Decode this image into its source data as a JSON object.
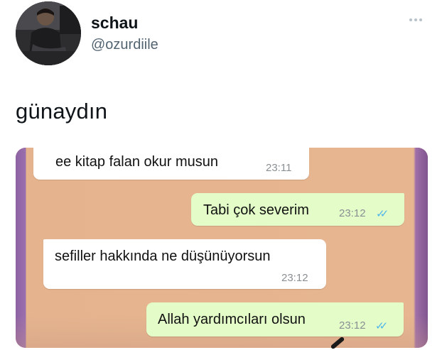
{
  "tweet": {
    "author": {
      "display_name": "schau",
      "handle": "@ozurdiile"
    },
    "text": "günaydın",
    "more_icon": "ellipsis-icon"
  },
  "chat": {
    "messages": [
      {
        "direction": "incoming",
        "text": "ee kitap falan okur musun",
        "time": "23:11"
      },
      {
        "direction": "outgoing",
        "text": "Tabi çok severim",
        "time": "23:12",
        "status": "✓✓"
      },
      {
        "direction": "incoming",
        "text": "sefiller hakkında ne düşünüyorsun",
        "time": "23:12"
      },
      {
        "direction": "outgoing",
        "text": "Allah yardımcıları olsun",
        "time": "23:12",
        "status": "✓✓"
      }
    ],
    "colors": {
      "incoming_bubble": "#ffffff",
      "outgoing_bubble": "#e3fcc8",
      "read_tick": "#4fb6ec",
      "background": "#e7b690"
    }
  }
}
